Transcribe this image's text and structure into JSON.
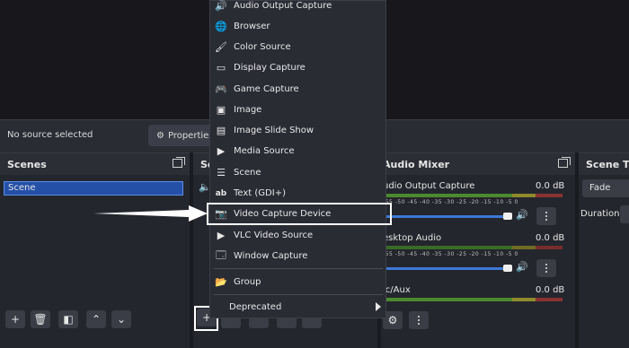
{
  "preview": {},
  "toolbar": {
    "no_source": "No source selected",
    "properties_label": "Properties"
  },
  "scenes": {
    "title": "Scenes",
    "items": [
      "Scene"
    ]
  },
  "sources": {
    "title": "So"
  },
  "audio_mixer": {
    "title": "Audio Mixer",
    "channels": [
      {
        "name": "udio Output Capture",
        "db": "0.0 dB"
      },
      {
        "name": "esktop Audio",
        "db": "0.0 dB"
      },
      {
        "name": "ic/Aux",
        "db": "0.0 dB"
      }
    ],
    "ticks": "-55 -50 -45 -40 -35 -30 -25 -20 -15 -10 -5 0"
  },
  "transitions": {
    "title": "Scene Tra",
    "mode": "Fade",
    "duration_label": "Duration"
  },
  "menu": {
    "items": [
      {
        "label": "Audio Output Capture",
        "icon": "speaker-icon"
      },
      {
        "label": "Browser",
        "icon": "globe-icon"
      },
      {
        "label": "Color Source",
        "icon": "brush-icon"
      },
      {
        "label": "Display Capture",
        "icon": "monitor-icon"
      },
      {
        "label": "Game Capture",
        "icon": "gamepad-icon"
      },
      {
        "label": "Image",
        "icon": "image-icon"
      },
      {
        "label": "Image Slide Show",
        "icon": "slideshow-icon"
      },
      {
        "label": "Media Source",
        "icon": "play-icon"
      },
      {
        "label": "Scene",
        "icon": "list-icon"
      },
      {
        "label": "Text (GDI+)",
        "icon": "text-icon"
      },
      {
        "label": "Video Capture Device",
        "icon": "camera-icon"
      },
      {
        "label": "VLC Video Source",
        "icon": "play-icon"
      },
      {
        "label": "Window Capture",
        "icon": "window-icon"
      },
      {
        "label": "Group",
        "icon": "folder-icon"
      },
      {
        "label": "Deprecated",
        "icon": "chevron-right-icon"
      }
    ]
  },
  "colors": {
    "accent": "#3c78d8",
    "highlight_box": "#ffffff",
    "meter_green": "#4b8a2e",
    "meter_yellow": "#8f8a2b",
    "meter_red": "#8a3232"
  }
}
